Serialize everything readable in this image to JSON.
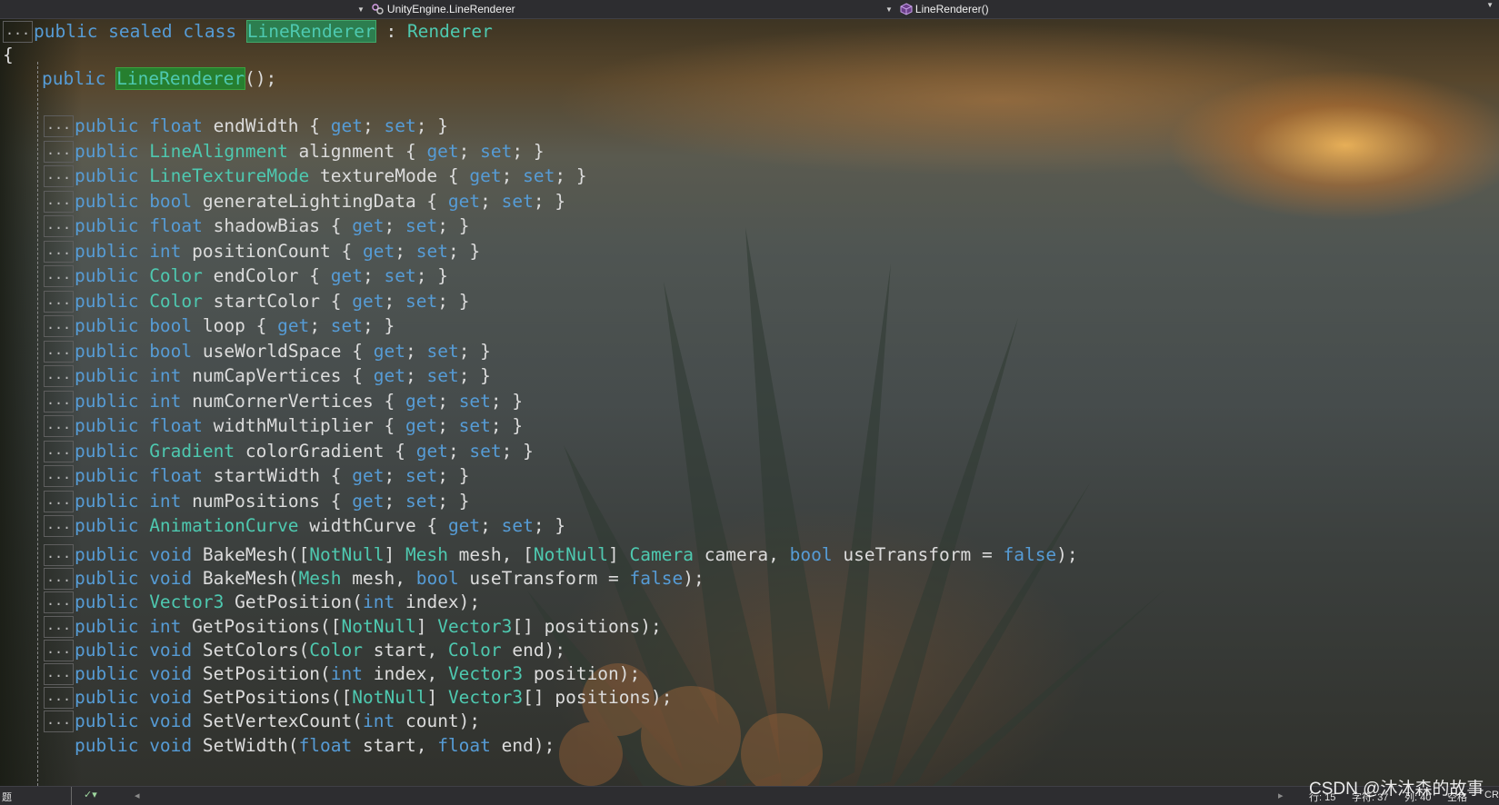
{
  "navbar": {
    "type_dropdown": "UnityEngine.LineRenderer",
    "member_dropdown": "LineRenderer()"
  },
  "code": {
    "class_decl": {
      "fold": "...",
      "kw": "public sealed class ",
      "name": "LineRenderer",
      "sep": " : ",
      "base": "Renderer"
    },
    "open_brace": "{",
    "ctor": {
      "kw": "public ",
      "name": "LineRenderer",
      "rest": "();"
    },
    "properties": [
      {
        "fold": "...",
        "mod": "public ",
        "type": "float",
        "type_kind": "kw",
        "name": " endWidth { ",
        "get": "get",
        "semi1": "; ",
        "set": "set",
        "end": "; }"
      },
      {
        "fold": "...",
        "mod": "public ",
        "type": "LineAlignment",
        "type_kind": "ty",
        "name": " alignment { ",
        "get": "get",
        "semi1": "; ",
        "set": "set",
        "end": "; }"
      },
      {
        "fold": "...",
        "mod": "public ",
        "type": "LineTextureMode",
        "type_kind": "ty",
        "name": " textureMode { ",
        "get": "get",
        "semi1": "; ",
        "set": "set",
        "end": "; }"
      },
      {
        "fold": "...",
        "mod": "public ",
        "type": "bool",
        "type_kind": "kw",
        "name": " generateLightingData { ",
        "get": "get",
        "semi1": "; ",
        "set": "set",
        "end": "; }"
      },
      {
        "fold": "...",
        "mod": "public ",
        "type": "float",
        "type_kind": "kw",
        "name": " shadowBias { ",
        "get": "get",
        "semi1": "; ",
        "set": "set",
        "end": "; }"
      },
      {
        "fold": "...",
        "mod": "public ",
        "type": "int",
        "type_kind": "kw",
        "name": " positionCount { ",
        "get": "get",
        "semi1": "; ",
        "set": "set",
        "end": "; }"
      },
      {
        "fold": "...",
        "mod": "public ",
        "type": "Color",
        "type_kind": "ty",
        "name": " endColor { ",
        "get": "get",
        "semi1": "; ",
        "set": "set",
        "end": "; }"
      },
      {
        "fold": "...",
        "mod": "public ",
        "type": "Color",
        "type_kind": "ty",
        "name": " startColor { ",
        "get": "get",
        "semi1": "; ",
        "set": "set",
        "end": "; }"
      },
      {
        "fold": "...",
        "mod": "public ",
        "type": "bool",
        "type_kind": "kw",
        "name": " loop { ",
        "get": "get",
        "semi1": "; ",
        "set": "set",
        "end": "; }"
      },
      {
        "fold": "...",
        "mod": "public ",
        "type": "bool",
        "type_kind": "kw",
        "name": " useWorldSpace { ",
        "get": "get",
        "semi1": "; ",
        "set": "set",
        "end": "; }"
      },
      {
        "fold": "...",
        "mod": "public ",
        "type": "int",
        "type_kind": "kw",
        "name": " numCapVertices { ",
        "get": "get",
        "semi1": "; ",
        "set": "set",
        "end": "; }"
      },
      {
        "fold": "...",
        "mod": "public ",
        "type": "int",
        "type_kind": "kw",
        "name": " numCornerVertices { ",
        "get": "get",
        "semi1": "; ",
        "set": "set",
        "end": "; }"
      },
      {
        "fold": "...",
        "mod": "public ",
        "type": "float",
        "type_kind": "kw",
        "name": " widthMultiplier { ",
        "get": "get",
        "semi1": "; ",
        "set": "set",
        "end": "; }"
      },
      {
        "fold": "...",
        "mod": "public ",
        "type": "Gradient",
        "type_kind": "ty",
        "name": " colorGradient { ",
        "get": "get",
        "semi1": "; ",
        "set": "set",
        "end": "; }"
      },
      {
        "fold": "...",
        "mod": "public ",
        "type": "float",
        "type_kind": "kw",
        "name": " startWidth { ",
        "get": "get",
        "semi1": "; ",
        "set": "set",
        "end": "; }"
      },
      {
        "fold": "...",
        "mod": "public ",
        "type": "int",
        "type_kind": "kw",
        "name": " numPositions { ",
        "get": "get",
        "semi1": "; ",
        "set": "set",
        "end": "; }"
      },
      {
        "fold": "...",
        "mod": "public ",
        "type": "AnimationCurve",
        "type_kind": "ty",
        "name": " widthCurve { ",
        "get": "get",
        "semi1": "; ",
        "set": "set",
        "end": "; }"
      }
    ],
    "methods": [
      {
        "fold": "...",
        "tokens": [
          [
            "public ",
            "kw"
          ],
          [
            "void",
            "kw"
          ],
          [
            " BakeMesh([",
            ""
          ],
          [
            "NotNull",
            "ty"
          ],
          [
            "] ",
            ""
          ],
          [
            "Mesh",
            "ty"
          ],
          [
            " mesh, [",
            ""
          ],
          [
            "NotNull",
            "ty"
          ],
          [
            "] ",
            ""
          ],
          [
            "Camera",
            "ty"
          ],
          [
            " camera, ",
            ""
          ],
          [
            "bool",
            "kw"
          ],
          [
            " useTransform = ",
            ""
          ],
          [
            "false",
            "kw"
          ],
          [
            ");",
            ""
          ]
        ]
      },
      {
        "fold": "...",
        "tokens": [
          [
            "public ",
            "kw"
          ],
          [
            "void",
            "kw"
          ],
          [
            " BakeMesh(",
            ""
          ],
          [
            "Mesh",
            "ty"
          ],
          [
            " mesh, ",
            ""
          ],
          [
            "bool",
            "kw"
          ],
          [
            " useTransform = ",
            ""
          ],
          [
            "false",
            "kw"
          ],
          [
            ");",
            ""
          ]
        ]
      },
      {
        "fold": "...",
        "tokens": [
          [
            "public ",
            "kw"
          ],
          [
            "Vector3",
            "ty"
          ],
          [
            " GetPosition(",
            ""
          ],
          [
            "int",
            "kw"
          ],
          [
            " index);",
            ""
          ]
        ]
      },
      {
        "fold": "...",
        "tokens": [
          [
            "public ",
            "kw"
          ],
          [
            "int",
            "kw"
          ],
          [
            " GetPositions([",
            ""
          ],
          [
            "NotNull",
            "ty"
          ],
          [
            "] ",
            ""
          ],
          [
            "Vector3",
            "ty"
          ],
          [
            "[] positions);",
            ""
          ]
        ]
      },
      {
        "fold": "...",
        "tokens": [
          [
            "public ",
            "kw"
          ],
          [
            "void",
            "kw"
          ],
          [
            " SetColors(",
            ""
          ],
          [
            "Color",
            "ty"
          ],
          [
            " start, ",
            ""
          ],
          [
            "Color",
            "ty"
          ],
          [
            " end);",
            ""
          ]
        ]
      },
      {
        "fold": "...",
        "tokens": [
          [
            "public ",
            "kw"
          ],
          [
            "void",
            "kw"
          ],
          [
            " SetPosition(",
            ""
          ],
          [
            "int",
            "kw"
          ],
          [
            " index, ",
            ""
          ],
          [
            "Vector3",
            "ty"
          ],
          [
            " position);",
            ""
          ]
        ]
      },
      {
        "fold": "...",
        "tokens": [
          [
            "public ",
            "kw"
          ],
          [
            "void",
            "kw"
          ],
          [
            " SetPositions([",
            ""
          ],
          [
            "NotNull",
            "ty"
          ],
          [
            "] ",
            ""
          ],
          [
            "Vector3",
            "ty"
          ],
          [
            "[] positions);",
            ""
          ]
        ]
      },
      {
        "fold": "...",
        "tokens": [
          [
            "public ",
            "kw"
          ],
          [
            "void",
            "kw"
          ],
          [
            " SetVertexCount(",
            ""
          ],
          [
            "int",
            "kw"
          ],
          [
            " count);",
            ""
          ]
        ]
      },
      {
        "fold": "",
        "tokens": [
          [
            "public ",
            "kw"
          ],
          [
            "void",
            "kw"
          ],
          [
            " SetWidth(",
            ""
          ],
          [
            "float",
            "kw"
          ],
          [
            " start, ",
            ""
          ],
          [
            "float",
            "kw"
          ],
          [
            " end);",
            ""
          ]
        ]
      }
    ]
  },
  "statusbar": {
    "left_label": "题",
    "line": "行: 15",
    "char": "字符: 37",
    "col": "列: 40",
    "mode": "空格",
    "eol": "CR"
  },
  "watermark": "CSDN @沐沐森的故事",
  "colors": {
    "keyword": "#569cd6",
    "type": "#4ec9b0",
    "text": "#dcdcdc",
    "highlight": "#267f2f"
  }
}
